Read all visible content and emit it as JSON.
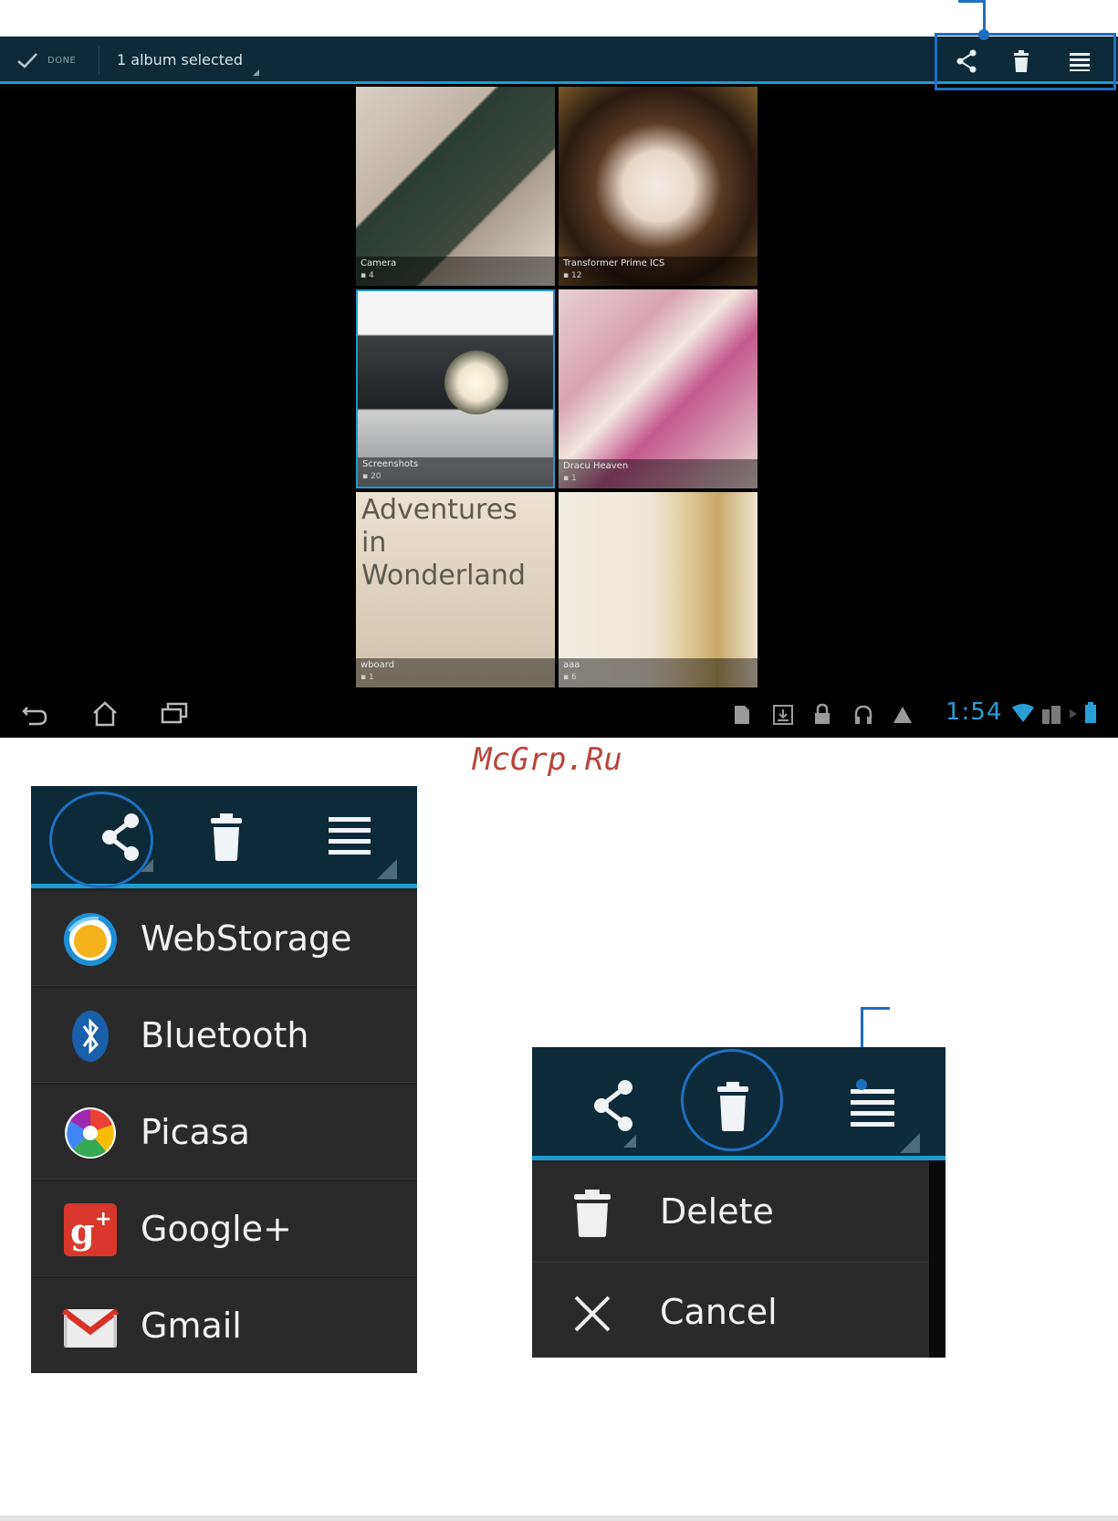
{
  "top_screen": {
    "done_label": "DONE",
    "selection_label": "1 album selected",
    "albums": [
      {
        "title": "Camera",
        "count": "4"
      },
      {
        "title": "Transformer Prime ICS",
        "count": "12"
      },
      {
        "title": "Screenshots",
        "count": "20"
      },
      {
        "title": "Dracu Heaven",
        "count": "1"
      },
      {
        "title": "wboard",
        "count": "1"
      },
      {
        "title": "aaa",
        "count": "6"
      }
    ],
    "tile_text": {
      "wonderland": "Adventures in Wonderland"
    },
    "clock": "1:54"
  },
  "watermark": "McGrp.Ru",
  "share_menu": {
    "items": [
      {
        "label": "WebStorage",
        "icon": "webstorage-icon"
      },
      {
        "label": "Bluetooth",
        "icon": "bluetooth-icon"
      },
      {
        "label": "Picasa",
        "icon": "picasa-icon"
      },
      {
        "label": "Google+",
        "icon": "googleplus-icon"
      },
      {
        "label": "Gmail",
        "icon": "gmail-icon"
      }
    ]
  },
  "delete_menu": {
    "items": [
      {
        "label": "Delete",
        "icon": "trash-icon"
      },
      {
        "label": "Cancel",
        "icon": "close-icon"
      }
    ]
  },
  "colors": {
    "action_bar": "#0c2a3a",
    "accent": "#1f9bd1",
    "callout": "#1f6fc0"
  }
}
